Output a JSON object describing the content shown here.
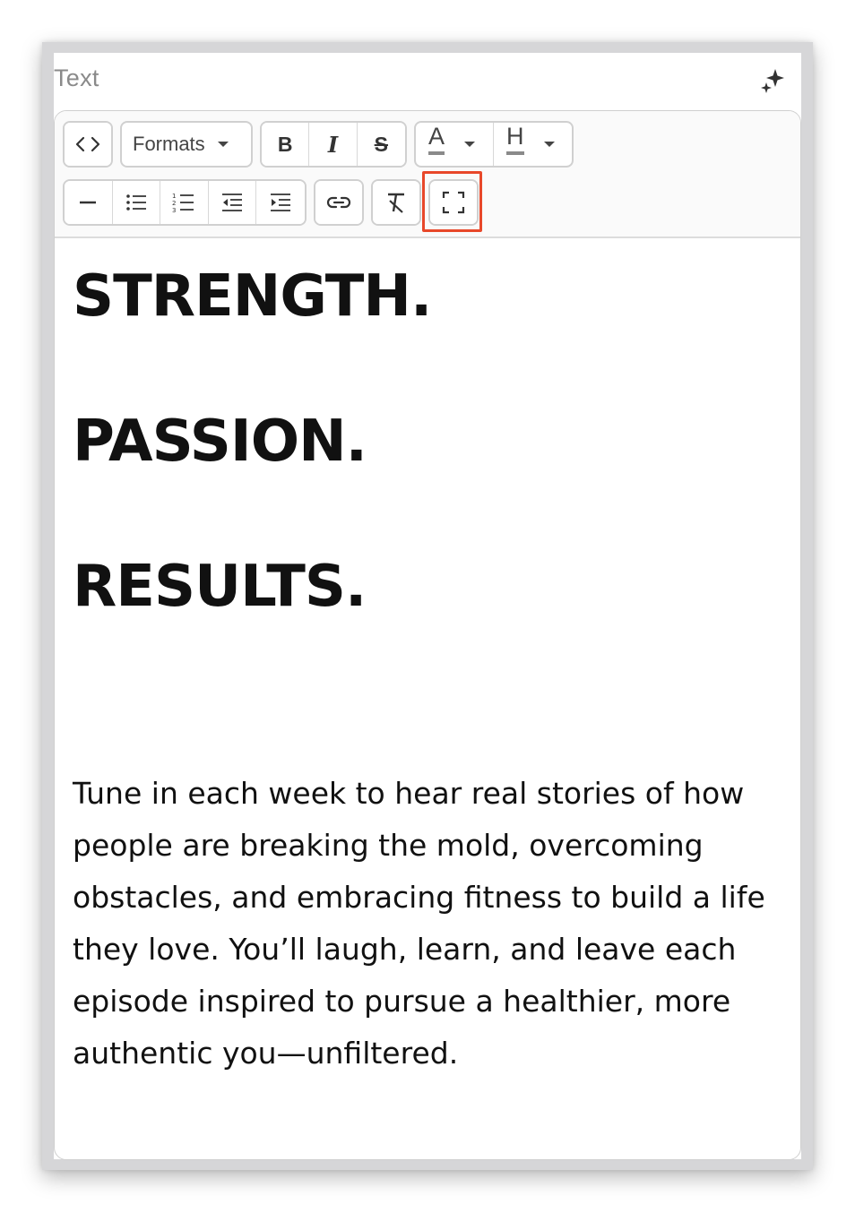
{
  "panel": {
    "title": "Text",
    "ai_icon": "sparkle-icon"
  },
  "toolbar": {
    "row1": {
      "source_code_icon": "code-icon",
      "formats_label": "Formats",
      "bold_label": "B",
      "italic_label": "I",
      "strike_label": "S",
      "text_color_label": "A",
      "highlight_label": "H"
    },
    "row2": {
      "icons": [
        "horizontal-rule-icon",
        "bullet-list-icon",
        "numbered-list-icon",
        "outdent-icon",
        "indent-icon",
        "link-icon",
        "clear-format-icon",
        "fullscreen-icon"
      ]
    },
    "highlight_color": "#e8482a"
  },
  "content": {
    "headlines": [
      "STRENGTH.",
      "PASSION.",
      "RESULTS."
    ],
    "paragraph": "Tune in each week to hear real stories of how people are breaking the mold, overcoming obstacles, and embracing fitness to build a life they love. You’ll laugh, learn, and leave each episode inspired to pursue a healthier, more authentic you—unfiltered."
  }
}
